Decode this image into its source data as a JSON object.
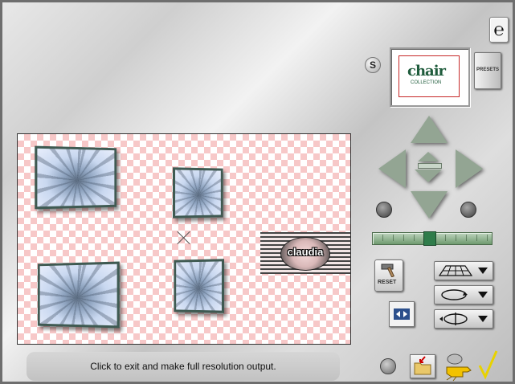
{
  "window": {
    "title": ""
  },
  "preview": {
    "text": "chair",
    "subtext": "COLLECTION"
  },
  "buttons": {
    "s_label": "S",
    "presets_label": "PRESETS",
    "reset_label": "RESET"
  },
  "canvas": {
    "watermark": "claudia"
  },
  "status": {
    "message": "Click to exit and make full resolution output."
  },
  "slider": {
    "position_fraction": 0.5
  },
  "colors": {
    "checker_pink": "#f7c8c8",
    "arrow_green": "#93a593",
    "status_bg": "#cccccc"
  },
  "icons": [
    "logo-icon",
    "arrow-up-icon",
    "arrow-down-icon",
    "arrow-left-icon",
    "arrow-right-icon",
    "rotate-left-icon",
    "rotate-right-icon",
    "hammer-icon",
    "perspective-icon",
    "rotate-icon",
    "flip-icon",
    "fit-icon",
    "grid-icon",
    "folder-icon",
    "pointer-hand-icon",
    "checkmark-icon"
  ]
}
